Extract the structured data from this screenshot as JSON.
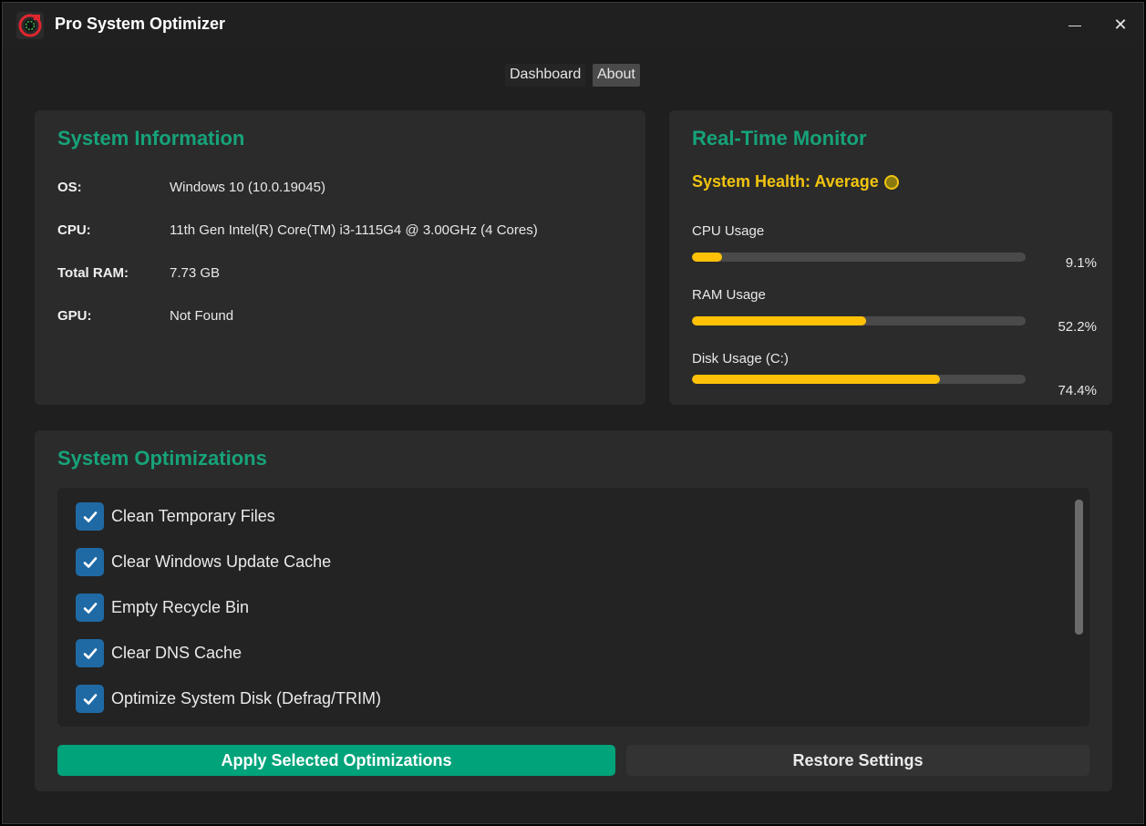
{
  "window": {
    "title": "Pro System Optimizer",
    "minimize_glyph": "—",
    "close_glyph": "✕"
  },
  "nav": {
    "tabs": [
      {
        "label": "Dashboard",
        "active": false
      },
      {
        "label": "About",
        "active": true
      }
    ]
  },
  "system_info": {
    "title": "System Information",
    "rows": [
      {
        "label": "OS:",
        "value": "Windows 10 (10.0.19045)"
      },
      {
        "label": "CPU:",
        "value": "11th Gen Intel(R) Core(TM) i3-1115G4 @ 3.00GHz (4 Cores)"
      },
      {
        "label": "Total RAM:",
        "value": "7.73 GB"
      },
      {
        "label": "GPU:",
        "value": "Not Found"
      }
    ]
  },
  "monitor": {
    "title": "Real-Time Monitor",
    "health": "System Health: Average",
    "meters": [
      {
        "label": "CPU Usage",
        "value": 9.1,
        "text": "9.1%"
      },
      {
        "label": "RAM Usage",
        "value": 52.2,
        "text": "52.2%"
      },
      {
        "label": "Disk Usage (C:)",
        "value": 74.4,
        "text": "74.4%"
      }
    ]
  },
  "optimizations": {
    "title": "System Optimizations",
    "items": [
      {
        "label": "Clean Temporary Files",
        "checked": true
      },
      {
        "label": "Clear Windows Update Cache",
        "checked": true
      },
      {
        "label": "Empty Recycle Bin",
        "checked": true
      },
      {
        "label": "Clear DNS Cache",
        "checked": true
      },
      {
        "label": "Optimize System Disk (Defrag/TRIM)",
        "checked": true
      }
    ],
    "apply_label": "Apply Selected Optimizations",
    "restore_label": "Restore Settings"
  },
  "colors": {
    "accent_green": "#16a37a",
    "apply_button": "#00a37a",
    "meter_fill": "#ffc107",
    "health_text": "#f1c40f",
    "checkbox": "#1f6aa5"
  },
  "icons": {
    "app": "turbo-gauge-icon",
    "minimize": "minimize-icon",
    "close": "close-icon",
    "check": "checkmark-icon",
    "health": "status-dot-icon"
  }
}
